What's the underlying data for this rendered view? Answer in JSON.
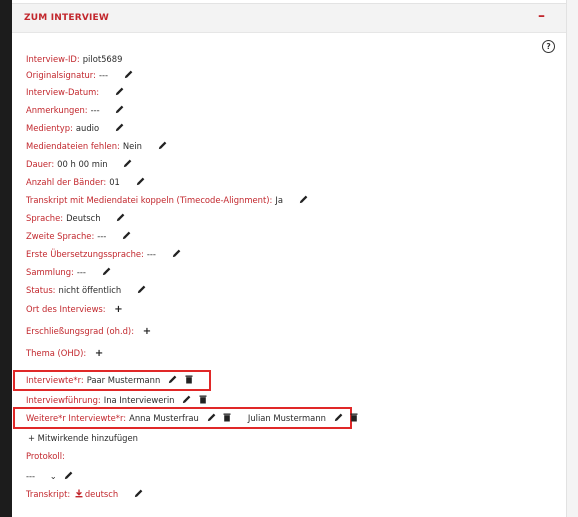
{
  "panel": {
    "title": "ZUM INTERVIEW",
    "collapse_label": "–",
    "help_label": "?"
  },
  "fields": {
    "interview_id": {
      "label": "Interview-ID:",
      "value": "pilot5689"
    },
    "originalsignatur": {
      "label": "Originalsignatur:",
      "value": "---"
    },
    "interview_datum": {
      "label": "Interview-Datum:"
    },
    "anmerkungen": {
      "label": "Anmerkungen:",
      "value": "---"
    },
    "medientyp": {
      "label": "Medientyp:",
      "value": "audio"
    },
    "mediendateien_fehlen": {
      "label": "Mediendateien fehlen:",
      "value": "Nein"
    },
    "dauer": {
      "label": "Dauer:",
      "value": "00 h 00 min"
    },
    "anzahl_baender": {
      "label": "Anzahl der Bänder:",
      "value": "01"
    },
    "transkript_koppeln": {
      "label": "Transkript mit Mediendatei koppeln (Timecode-Alignment):",
      "value": "Ja"
    },
    "sprache": {
      "label": "Sprache:",
      "value": "Deutsch"
    },
    "zweite_sprache": {
      "label": "Zweite Sprache:",
      "value": "---"
    },
    "erste_uebersetzungssprache": {
      "label": "Erste Übersetzungssprache:",
      "value": "---"
    },
    "sammlung": {
      "label": "Sammlung:",
      "value": "---"
    },
    "status": {
      "label": "Status:",
      "value": "nicht öffentlich"
    },
    "ort": {
      "label": "Ort des Interviews:"
    },
    "erschliessungsgrad": {
      "label": "Erschließungsgrad (oh.d):"
    },
    "thema": {
      "label": "Thema (OHD):"
    },
    "interviewte": {
      "label": "Interviewte*r:",
      "value": "Paar Mustermann"
    },
    "interviewfuehrung": {
      "label": "Interviewführung:",
      "value": "Ina Interviewerin"
    },
    "weitere_interviewte": {
      "label": "Weitere*r Interviewte*r:",
      "values": [
        "Anna Musterfrau",
        "Julian Mustermann"
      ]
    },
    "mitwirkende": {
      "label": "+ Mitwirkende hinzufügen"
    },
    "protokoll": {
      "label": "Protokoll:",
      "value": "---",
      "chevron": "⌄"
    },
    "transkript": {
      "label": "Transkript:",
      "link": "deutsch"
    }
  },
  "colors": {
    "accent": "#c2272d",
    "highlight": "#e02828"
  },
  "icons": [
    "pencil-icon",
    "trash-icon",
    "plus-icon",
    "help-icon",
    "download-icon"
  ]
}
